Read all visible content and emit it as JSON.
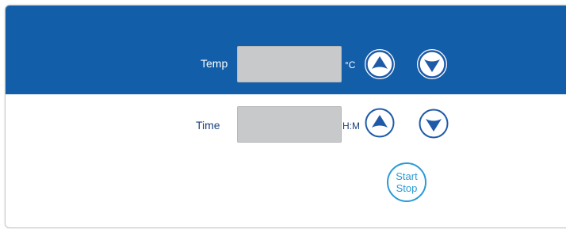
{
  "colors": {
    "header_band": "#135ea9",
    "accent_blue": "#1e5aa8",
    "start_stop": "#2b9ad6",
    "display_fill": "#c8c9cb"
  },
  "temp": {
    "label": "Temp",
    "value": "",
    "unit": "°C",
    "up_icon": "up-arrow-icon",
    "down_icon": "down-arrow-icon"
  },
  "time": {
    "label": "Time",
    "value": "",
    "unit": "H:M",
    "up_icon": "up-arrow-icon",
    "down_icon": "down-arrow-icon"
  },
  "start_stop": {
    "line1": "Start",
    "line2": "Stop"
  }
}
